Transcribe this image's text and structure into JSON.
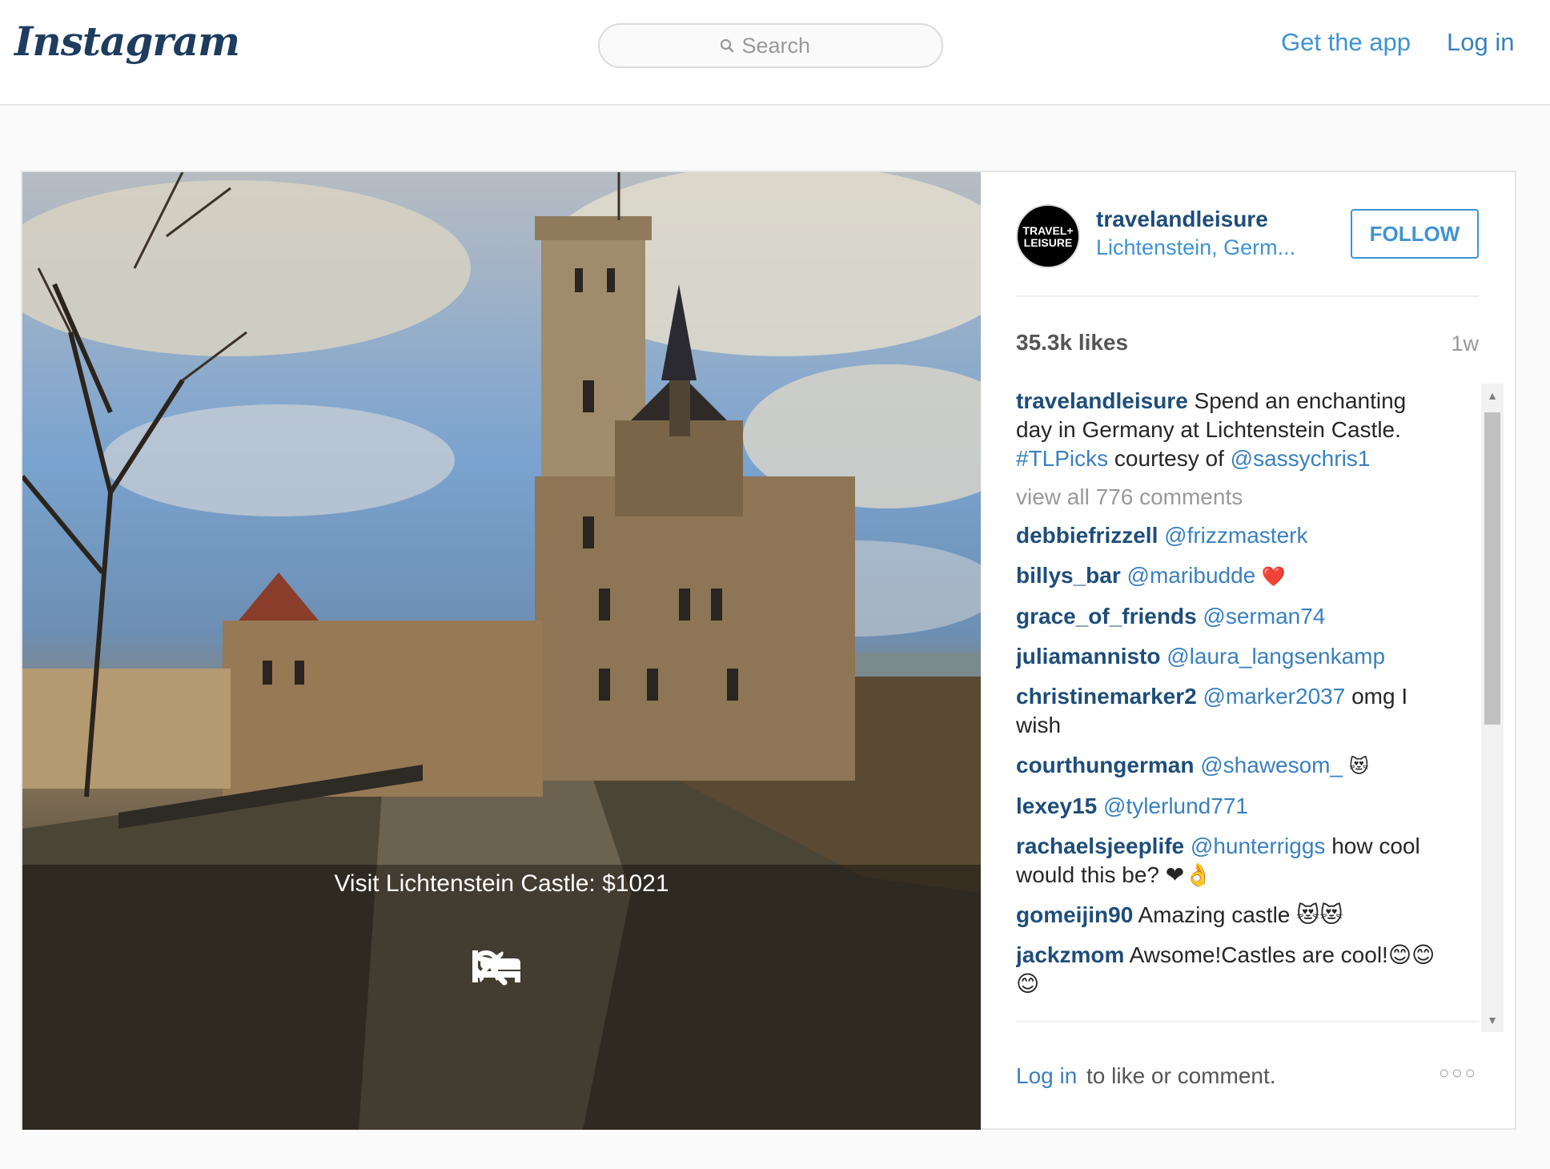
{
  "header": {
    "logo": "Instagram",
    "search_placeholder": "Search",
    "get_app": "Get the app",
    "login": "Log in"
  },
  "photo": {
    "caption": "Visit Lichtenstein Castle: $1021",
    "icons": [
      "bed-icon",
      "plane-icon",
      "search-icon"
    ]
  },
  "post": {
    "avatar_text": "TRAVEL+ LEISURE",
    "username": "travelandleisure",
    "location": "Lichtenstein, Germ...",
    "follow": "FOLLOW",
    "likes": "35.3k likes",
    "time": "1w",
    "caption": {
      "user": "travelandleisure",
      "text1": " Spend an enchanting day in Germany at Lichtenstein Castle. ",
      "hashtag": "#TLPicks",
      "text2": " courtesy of ",
      "mention": "@sassychris1"
    },
    "view_all": "view all 776 comments",
    "comments": [
      {
        "user": "debbiefrizzell",
        "mention": "@frizzmasterk",
        "text": ""
      },
      {
        "user": "billys_bar",
        "mention": "@maribudde",
        "text": " ❤️"
      },
      {
        "user": "grace_of_friends",
        "mention": "@serman74",
        "text": ""
      },
      {
        "user": "juliamannisto",
        "mention": "@laura_langsenkamp",
        "text": ""
      },
      {
        "user": "christinemarker2",
        "mention": "@marker2037",
        "text": " omg I wish"
      },
      {
        "user": "courthungerman",
        "mention": "@shawesom_",
        "text": " 😻"
      },
      {
        "user": "lexey15",
        "mention": "@tylerlund771",
        "text": ""
      },
      {
        "user": "rachaelsjeeplife",
        "mention": "@hunterriggs",
        "text": " how cool would this be? ❤👌"
      },
      {
        "user": "gomeijin90",
        "mention": "",
        "text": " Amazing castle 😻😻"
      },
      {
        "user": "jackzmom",
        "mention": "",
        "text": " Awsome!Castles are cool!😊😊😊"
      }
    ],
    "footer_login": "Log in",
    "footer_text": " to like or comment.",
    "more": "○○○"
  },
  "colors": {
    "link_blue": "#3f93d2",
    "username_navy": "#1e4d7a"
  }
}
